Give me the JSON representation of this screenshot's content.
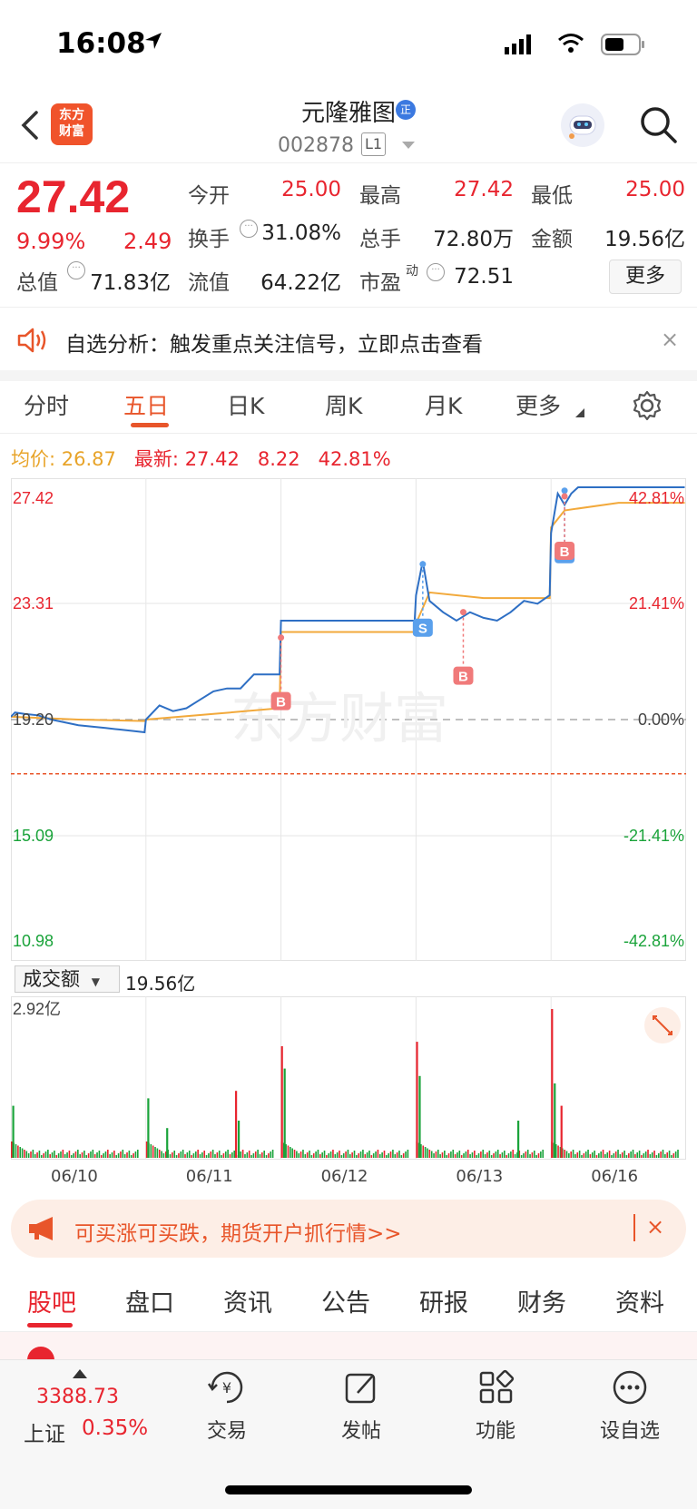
{
  "status": {
    "time": "16:08"
  },
  "header": {
    "logo": [
      "东方",
      "财富"
    ],
    "stock_name": "元隆雅图",
    "badge": "正",
    "stock_code": "002878",
    "level": "L1"
  },
  "quote": {
    "price": "27.42",
    "change_pct": "9.99%",
    "change": "2.49",
    "rows": [
      [
        {
          "label": "今开",
          "value": "25.00",
          "color": "red"
        },
        {
          "label": "最高",
          "value": "27.42",
          "color": "red"
        },
        {
          "label": "最低",
          "value": "25.00",
          "color": "red"
        }
      ],
      [
        {
          "label": "换手",
          "value": "31.08%",
          "color": "dark"
        },
        {
          "label": "总手",
          "value": "72.80万",
          "color": "dark"
        },
        {
          "label": "金额",
          "value": "19.56亿",
          "color": "dark"
        }
      ],
      [
        {
          "label": "流值",
          "value": "64.22亿",
          "color": "dark"
        },
        {
          "label": "市盈",
          "value": "72.51",
          "color": "dark"
        }
      ]
    ],
    "total_value_label": "总值",
    "total_value": "71.83亿",
    "pe_superscript": "动",
    "more_label": "更多"
  },
  "alert": {
    "text": "自选分析：触发重点关注信号，立即点击查看",
    "close": "×"
  },
  "tabs": [
    "分时",
    "五日",
    "日K",
    "周K",
    "月K",
    "更多"
  ],
  "active_tab": 1,
  "legend": {
    "avg_label": "均价:",
    "avg_value": "26.87",
    "latest_label": "最新:",
    "latest_value": "27.42",
    "latest_change": "8.22",
    "latest_pct": "42.81%"
  },
  "chart_data": {
    "type": "line",
    "title": "",
    "x_days": [
      "06/10",
      "06/11",
      "06/12",
      "06/13",
      "06/16"
    ],
    "ylim": [
      10.98,
      27.42
    ],
    "yticks_left": [
      "27.42",
      "23.31",
      "19.20",
      "15.09",
      "10.98"
    ],
    "yticks_right": [
      "42.81%",
      "21.41%",
      "0.00%",
      "-21.41%",
      "-42.81%"
    ],
    "prev_close": 19.2,
    "limit_down_line": 17.28,
    "series": [
      {
        "name": "最新",
        "color": "#2e6fc4",
        "x": [
          0,
          0.03,
          0.1,
          0.2,
          0.3,
          0.4,
          0.5,
          0.6,
          0.7,
          0.8,
          0.9,
          0.99,
          1.0,
          1.1,
          1.2,
          1.3,
          1.4,
          1.5,
          1.6,
          1.7,
          1.8,
          1.99,
          2.0,
          2.5,
          2.99,
          3.0,
          3.05,
          3.1,
          3.2,
          3.3,
          3.4,
          3.5,
          3.6,
          3.7,
          3.8,
          3.9,
          3.99,
          4.0,
          4.05,
          4.1,
          4.15,
          4.2,
          4.3,
          4.5,
          4.99
        ],
        "y": [
          19.3,
          19.45,
          19.4,
          19.35,
          19.2,
          19.1,
          19.0,
          18.95,
          18.9,
          18.85,
          18.8,
          18.75,
          19.2,
          19.7,
          19.5,
          19.6,
          19.9,
          20.2,
          20.3,
          20.3,
          20.8,
          20.8,
          22.7,
          22.7,
          22.7,
          23.6,
          24.8,
          23.4,
          23.0,
          22.7,
          23.0,
          22.8,
          22.7,
          23.0,
          23.4,
          23.3,
          23.6,
          25.8,
          27.2,
          26.8,
          27.2,
          27.42,
          27.42,
          27.42,
          27.42
        ]
      },
      {
        "name": "均价",
        "color": "#f2a93b",
        "x": [
          0,
          0.5,
          0.99,
          1.0,
          1.5,
          1.99,
          2.0,
          2.99,
          3.0,
          3.1,
          3.5,
          3.99,
          4.0,
          4.1,
          4.5,
          4.99
        ],
        "y": [
          19.3,
          19.2,
          19.15,
          19.2,
          19.4,
          19.6,
          22.3,
          22.3,
          22.6,
          23.7,
          23.5,
          23.5,
          26.0,
          26.6,
          26.87,
          26.87
        ]
      }
    ],
    "markers": [
      {
        "type": "B",
        "x": 2.0,
        "y": 22.1,
        "color": "#f07a7a"
      },
      {
        "type": "S",
        "x": 3.05,
        "y": 24.7,
        "color": "#5aa0ec"
      },
      {
        "type": "B",
        "x": 3.35,
        "y": 23.0,
        "color": "#f07a7a"
      },
      {
        "type": "S",
        "x": 4.1,
        "y": 27.3,
        "color": "#5aa0ec"
      },
      {
        "type": "B",
        "x": 4.1,
        "y": 27.1,
        "color": "#f07a7a"
      }
    ]
  },
  "volume": {
    "label": "成交额",
    "total": "19.56亿",
    "max_label": "2.92亿",
    "spikes": [
      {
        "x": 0.01,
        "v": 0.35,
        "color": "#1aa33a"
      },
      {
        "x": 1.01,
        "v": 0.4,
        "color": "#1aa33a"
      },
      {
        "x": 1.15,
        "v": 0.2,
        "color": "#1aa33a"
      },
      {
        "x": 1.68,
        "v": 0.25,
        "color": "#1aa33a"
      },
      {
        "x": 1.66,
        "v": 0.45,
        "color": "#e8252f"
      },
      {
        "x": 2.0,
        "v": 0.75,
        "color": "#e8252f"
      },
      {
        "x": 2.02,
        "v": 0.6,
        "color": "#1aa33a"
      },
      {
        "x": 3.0,
        "v": 0.78,
        "color": "#e8252f"
      },
      {
        "x": 3.02,
        "v": 0.55,
        "color": "#1aa33a"
      },
      {
        "x": 3.75,
        "v": 0.25,
        "color": "#1aa33a"
      },
      {
        "x": 4.0,
        "v": 1.0,
        "color": "#e8252f"
      },
      {
        "x": 4.02,
        "v": 0.5,
        "color": "#1aa33a"
      },
      {
        "x": 4.07,
        "v": 0.35,
        "color": "#e8252f"
      }
    ]
  },
  "ad": {
    "text": "可买涨可买跌，期货开户抓行情>>",
    "close": "×"
  },
  "bottom_tabs": [
    "股吧",
    "盘口",
    "资讯",
    "公告",
    "研报",
    "财务",
    "资料"
  ],
  "active_bottom_tab": 0,
  "nav": {
    "index_value": "3388.73",
    "index_name": "上证",
    "index_pct": "0.35%",
    "items": [
      {
        "label": "交易",
        "icon": "trade-yen-icon"
      },
      {
        "label": "发帖",
        "icon": "compose-icon"
      },
      {
        "label": "功能",
        "icon": "grid-icon"
      },
      {
        "label": "设自选",
        "icon": "more-dots-icon"
      }
    ]
  }
}
